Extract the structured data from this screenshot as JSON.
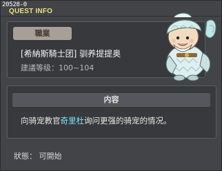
{
  "window": {
    "quest_id": "20528-0",
    "title": "QUEST INFO"
  },
  "job_panel": {
    "header": "職業",
    "name": "[希納斯騎士团] 驯养提提奥",
    "level": "建議等级：100~104"
  },
  "content_panel": {
    "header": "内容",
    "text_before": "向骑宠教官",
    "npc_name": "奇里杜",
    "text_after": "询问更强的骑宠的情况。"
  },
  "status": {
    "text": "狀態：  可開始"
  },
  "colors": {
    "title_yellow": "#e9e07a",
    "npc_highlight": "#7fe0ff",
    "background": "#434448"
  },
  "icons": {
    "character": "penguin-bird-npc-sprite"
  }
}
